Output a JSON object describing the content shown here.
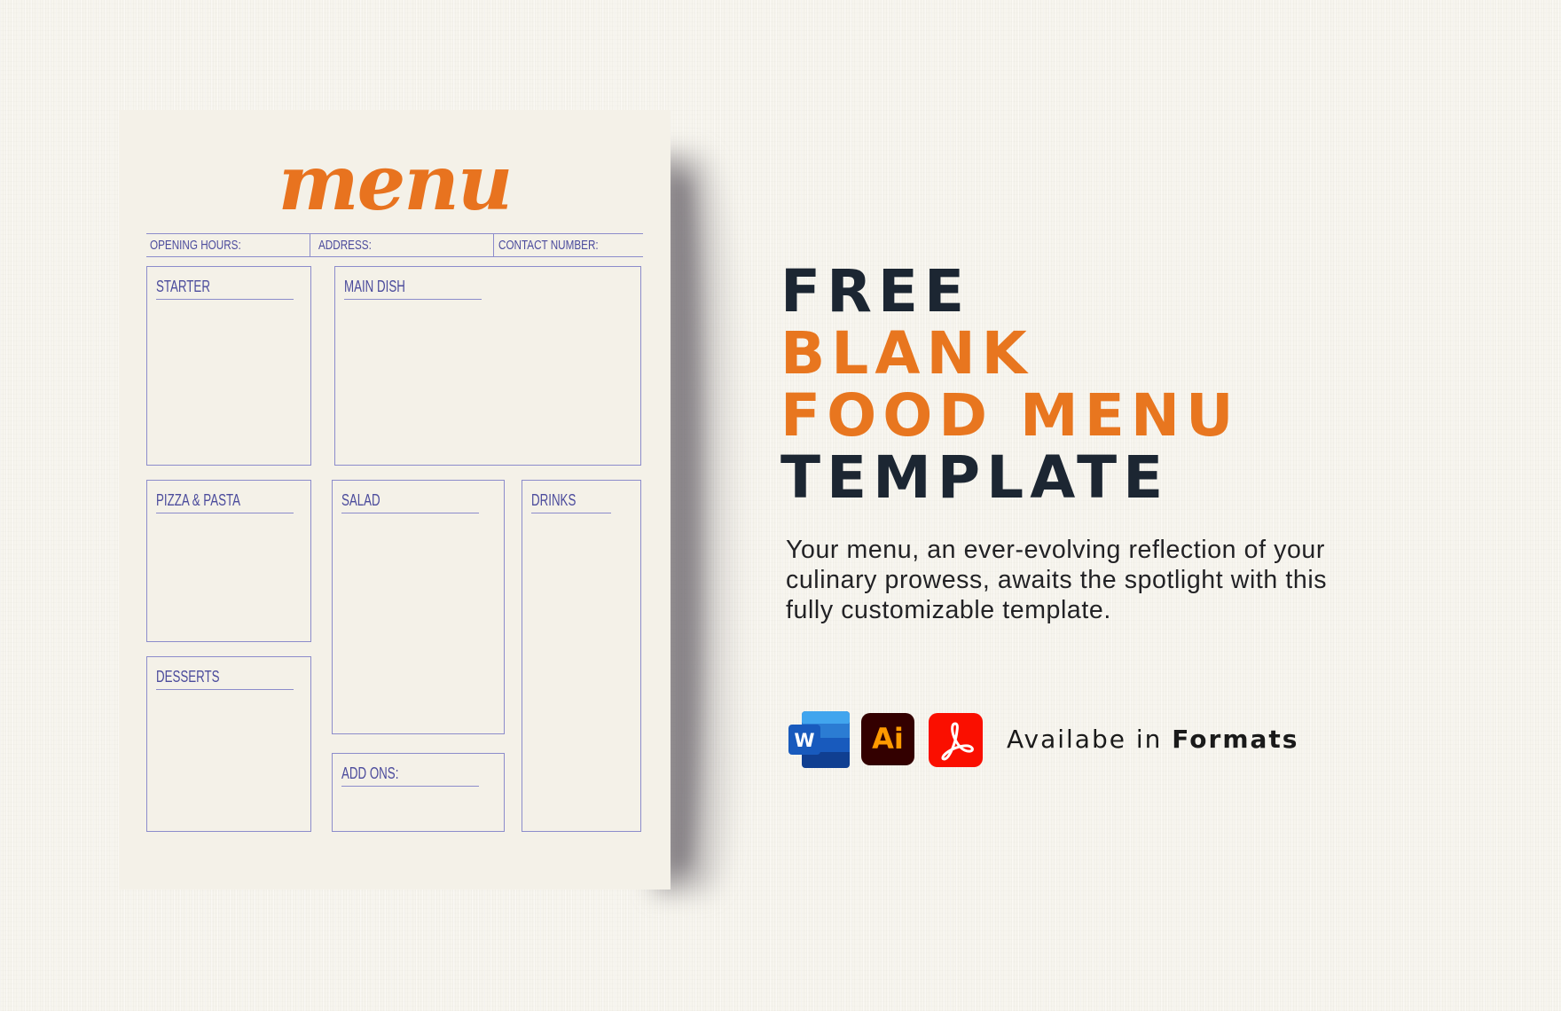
{
  "menu_template": {
    "logo": "menu",
    "info_row": {
      "opening_hours": "OPENING HOURS:",
      "address": "ADDRESS:",
      "contact_number": "CONTACT NUMBER:"
    },
    "sections": {
      "starter": "STARTER",
      "main_dish": "MAIN DISH",
      "pizza_pasta": "PIZZA & PASTA",
      "salad": "SALAD",
      "drinks": "DRINKS",
      "desserts": "DESSERTS",
      "add_ons": "ADD ONS:"
    }
  },
  "headline": {
    "line1": "FREE",
    "line2": "BLANK",
    "line3": "FOOD MENU",
    "line4": "TEMPLATE"
  },
  "description": {
    "line1": "Your menu, an ever-evolving reflection of your",
    "line2": "culinary prowess, awaits the spotlight with this",
    "line3": "fully customizable template."
  },
  "formats": {
    "icons": [
      "word-icon",
      "adobe-illustrator-icon",
      "adobe-acrobat-pdf-icon"
    ],
    "ai_label": "Ai",
    "word_label": "W",
    "text_prefix": "Availabe in",
    "text_bold": "Formats"
  },
  "colors": {
    "accent_orange": "#e8761f",
    "headline_dark": "#1c2632",
    "template_line": "#8c8ccb",
    "template_text": "#4b4b9c",
    "paper": "#f4f1e8"
  }
}
